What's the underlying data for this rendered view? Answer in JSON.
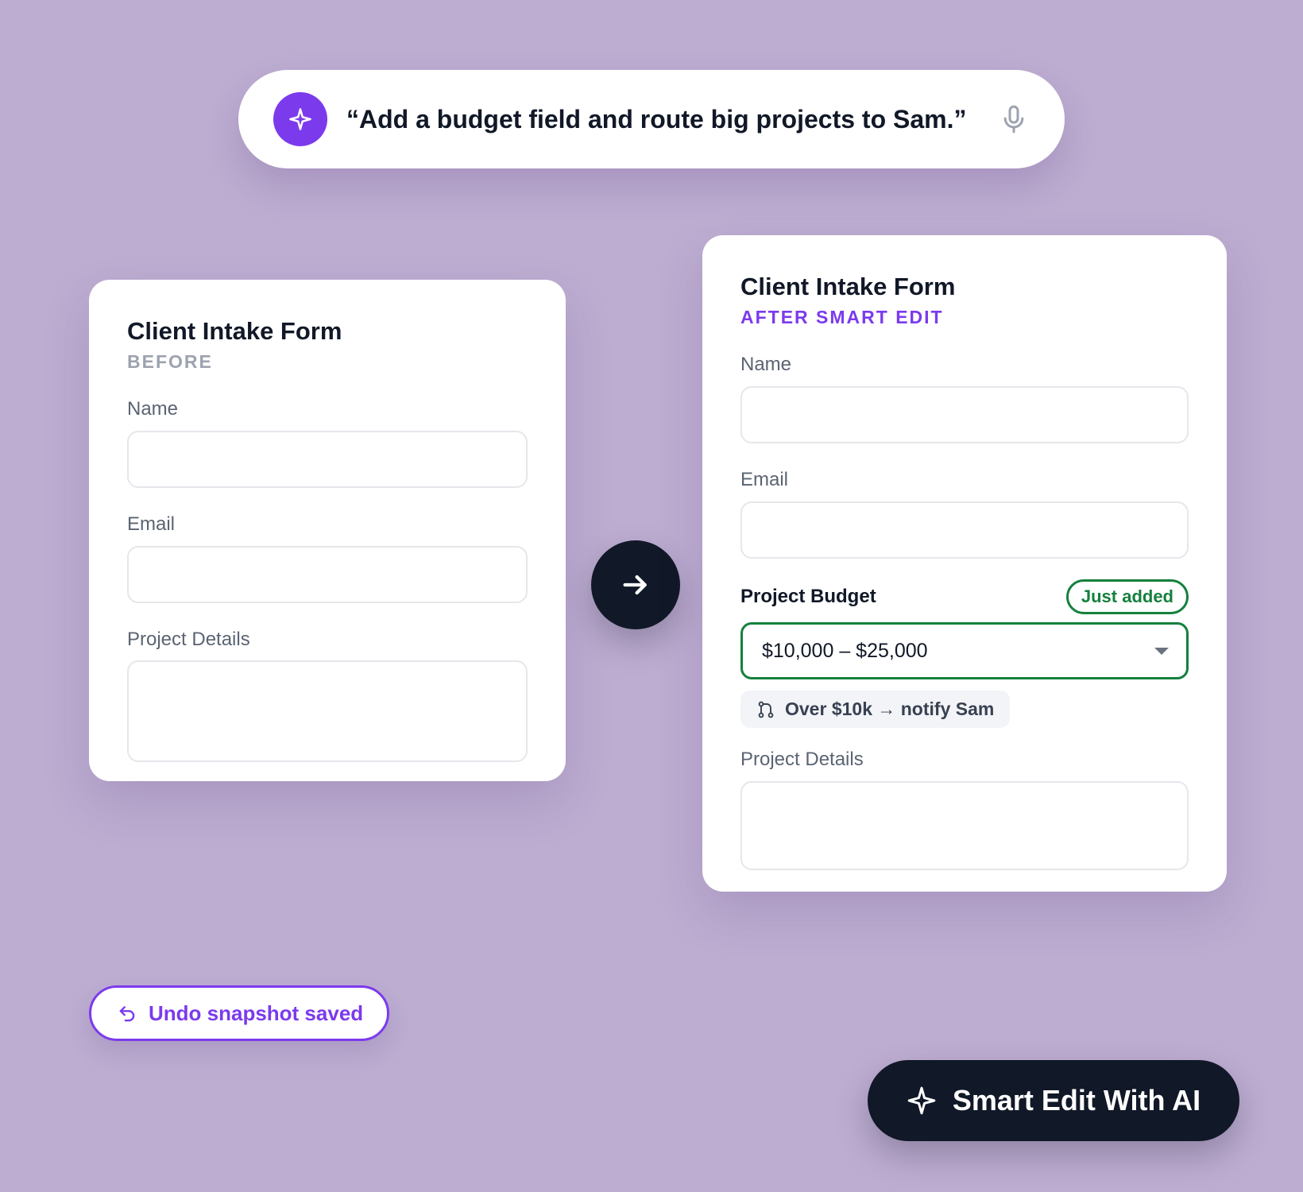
{
  "prompt": {
    "text": "“Add a budget field and route big projects to Sam.”",
    "leading_icon": "sparkle-icon",
    "trailing_icon": "microphone-icon"
  },
  "before_card": {
    "title": "Client Intake Form",
    "subtitle": "BEFORE",
    "fields": {
      "name_label": "Name",
      "email_label": "Email",
      "details_label": "Project Details"
    }
  },
  "transition": {
    "icon": "arrow-right-icon"
  },
  "after_card": {
    "title": "Client Intake Form",
    "subtitle": "AFTER SMART EDIT",
    "fields": {
      "name_label": "Name",
      "email_label": "Email",
      "budget_label": "Project Budget",
      "budget_badge": "Just added",
      "budget_value": "$10,000 – $25,000",
      "rule_text": "Over $10k → notify Sam",
      "rule_icon": "routing-icon",
      "details_label": "Project Details"
    }
  },
  "undo": {
    "label": "Undo snapshot saved",
    "icon": "undo-icon"
  },
  "smart_edit_button": {
    "label": "Smart Edit With AI",
    "icon": "sparkle-icon"
  },
  "colors": {
    "background": "#bdadd1",
    "accent_purple": "#7c3aed",
    "dark": "#111827",
    "success_green": "#15803d"
  }
}
